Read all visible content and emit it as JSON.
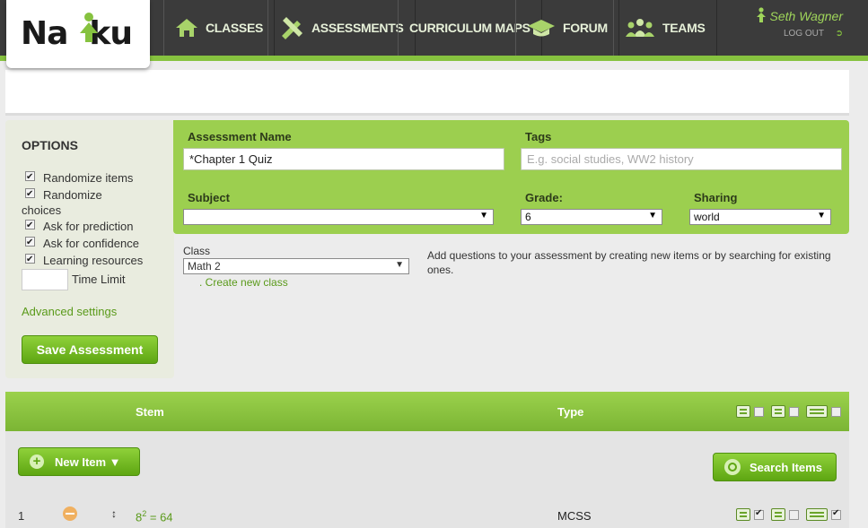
{
  "brand": {
    "logo_left": "Na",
    "logo_right": "ku"
  },
  "nav": [
    {
      "label": "CLASSES",
      "icon": "house-icon"
    },
    {
      "label": "ASSESSMENTS",
      "icon": "pencil-ruler-icon"
    },
    {
      "label": "CURRICULUM MAPS",
      "icon": ""
    },
    {
      "label": "FORUM",
      "icon": "graduation-cap-icon"
    },
    {
      "label": "TEAMS",
      "icon": "team-icon"
    }
  ],
  "user": {
    "name": "Seth Wagner",
    "logout": "LOG OUT"
  },
  "options": {
    "title": "OPTIONS",
    "items": [
      {
        "label": "Randomize items",
        "checked": true
      },
      {
        "label": "Randomize choices",
        "checked": true
      },
      {
        "label": "Ask for prediction",
        "checked": true
      },
      {
        "label": "Ask for confidence",
        "checked": true
      },
      {
        "label": "Learning resources",
        "checked": true
      }
    ],
    "time_limit_label": "Time Limit",
    "time_limit_value": "",
    "advanced": "Advanced settings",
    "save": "Save Assessment"
  },
  "form": {
    "name_label": "Assessment Name",
    "name_value": "*Chapter 1 Quiz",
    "tags_label": "Tags",
    "tags_placeholder": "E.g. social studies, WW2 history",
    "subject_label": "Subject",
    "subject_value": "",
    "grade_label": "Grade:",
    "grade_value": "6",
    "sharing_label": "Sharing",
    "sharing_value": "world"
  },
  "class": {
    "label": "Class",
    "value": "Math 2",
    "create": ". Create new class"
  },
  "hint": "Add questions to your assessment by creating new items or by searching for existing ones.",
  "table": {
    "stem_header": "Stem",
    "type_header": "Type",
    "new_item": "New Item ▼",
    "search_items": "Search Items",
    "rows": [
      {
        "num": "1",
        "stem_base": "8",
        "stem_exp": "2",
        "stem_rest": " = 64",
        "type": "MCSS"
      }
    ]
  },
  "colors": {
    "accent": "#86c23f",
    "nav_bg": "#3b3b3b",
    "panel": "#9ccf4f"
  }
}
